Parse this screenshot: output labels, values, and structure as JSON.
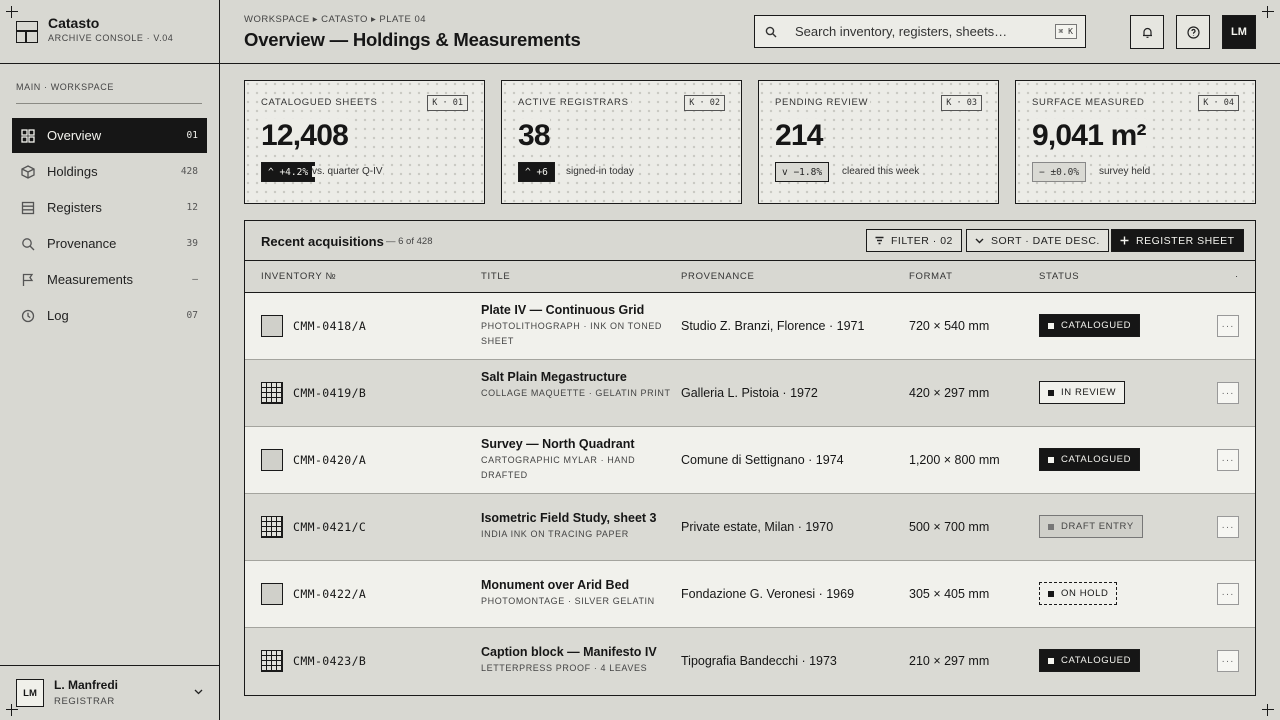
{
  "app": {
    "name": "Catasto",
    "subtitle": "ARCHIVE CONSOLE · V.04"
  },
  "sidebar": {
    "section": "MAIN · WORKSPACE",
    "items": [
      {
        "label": "Overview",
        "count": "01",
        "icon": "overview-grid-icon",
        "active": true
      },
      {
        "label": "Holdings",
        "count": "428",
        "icon": "holdings-box-icon"
      },
      {
        "label": "Registers",
        "count": "12",
        "icon": "registers-stack-icon"
      },
      {
        "label": "Provenance",
        "count": "39",
        "icon": "search-icon"
      },
      {
        "label": "Measurements",
        "count": "—",
        "icon": "flag-icon"
      },
      {
        "label": "Log",
        "count": "07",
        "icon": "clock-icon"
      }
    ]
  },
  "user": {
    "initials": "LM",
    "name": "L. Manfredi",
    "role": "REGISTRAR"
  },
  "header": {
    "breadcrumb": "WORKSPACE ▸ CATASTO ▸ PLATE 04",
    "title": "Overview — Holdings & Measurements",
    "search_placeholder": "Search inventory, registers, sheets…",
    "shortcut": "⌘ K",
    "avatar": "LM"
  },
  "kpis": [
    {
      "label": "CATALOGUED SHEETS",
      "code": "K · 01",
      "value": "12,408",
      "delta": "^ +4.2%",
      "note": "vs. quarter Q-IV"
    },
    {
      "label": "ACTIVE REGISTRARS",
      "code": "K · 02",
      "value": "38",
      "delta": "^ +6",
      "note": "signed-in today"
    },
    {
      "label": "PENDING REVIEW",
      "code": "K · 03",
      "value": "214",
      "delta": "v −1.8%",
      "note": "cleared this week"
    },
    {
      "label": "SURFACE MEASURED",
      "code": "K · 04",
      "value": "9,041 m²",
      "delta": "− ±0.0%",
      "note": "survey held"
    }
  ],
  "table": {
    "title": "Recent acquisitions",
    "subtitle": "— 6 of 428",
    "filter_label": "FILTER · 02",
    "sort_label": "SORT · DATE DESC.",
    "register_label": "REGISTER SHEET",
    "columns": [
      "INVENTORY №",
      "TITLE",
      "PROVENANCE",
      "FORMAT",
      "STATUS",
      "·"
    ],
    "rows": [
      {
        "inv": "CMM-0418/A",
        "title": "Plate IV — Continuous Grid",
        "sub": "PHOTOLITHOGRAPH · INK ON TONED SHEET",
        "prov": "Studio Z. Branzi, Florence · 1971",
        "format": "720 × 540 mm",
        "status": "CATALOGUED",
        "thumb": "plain"
      },
      {
        "inv": "CMM-0419/B",
        "title": "Salt Plain Megastructure",
        "sub": "COLLAGE MAQUETTE · GELATIN PRINT",
        "prov": "Galleria L. Pistoia · 1972",
        "format": "420 × 297 mm",
        "status": "IN REVIEW",
        "thumb": "grid"
      },
      {
        "inv": "CMM-0420/A",
        "title": "Survey — North Quadrant",
        "sub": "CARTOGRAPHIC MYLAR · HAND DRAFTED",
        "prov": "Comune di Settignano · 1974",
        "format": "1,200 × 800 mm",
        "status": "CATALOGUED",
        "thumb": "plain"
      },
      {
        "inv": "CMM-0421/C",
        "title": "Isometric Field Study, sheet 3",
        "sub": "INDIA INK ON TRACING PAPER",
        "prov": "Private estate, Milan · 1970",
        "format": "500 × 700 mm",
        "status": "DRAFT ENTRY",
        "thumb": "grid"
      },
      {
        "inv": "CMM-0422/A",
        "title": "Monument over Arid Bed",
        "sub": "PHOTOMONTAGE · SILVER GELATIN",
        "prov": "Fondazione G. Veronesi · 1969",
        "format": "305 × 405 mm",
        "status": "ON HOLD",
        "thumb": "plain"
      },
      {
        "inv": "CMM-0423/B",
        "title": "Caption block — Manifesto IV",
        "sub": "LETTERPRESS PROOF · 4 LEAVES",
        "prov": "Tipografia Bandecchi · 1973",
        "format": "210 × 297 mm",
        "status": "CATALOGUED",
        "thumb": "grid"
      }
    ]
  },
  "colors": {
    "ink": "#161616",
    "paper": "#d8d8d2",
    "card": "#ecece7",
    "row_light": "#f1f1ec",
    "row_dark": "#dadad4"
  }
}
